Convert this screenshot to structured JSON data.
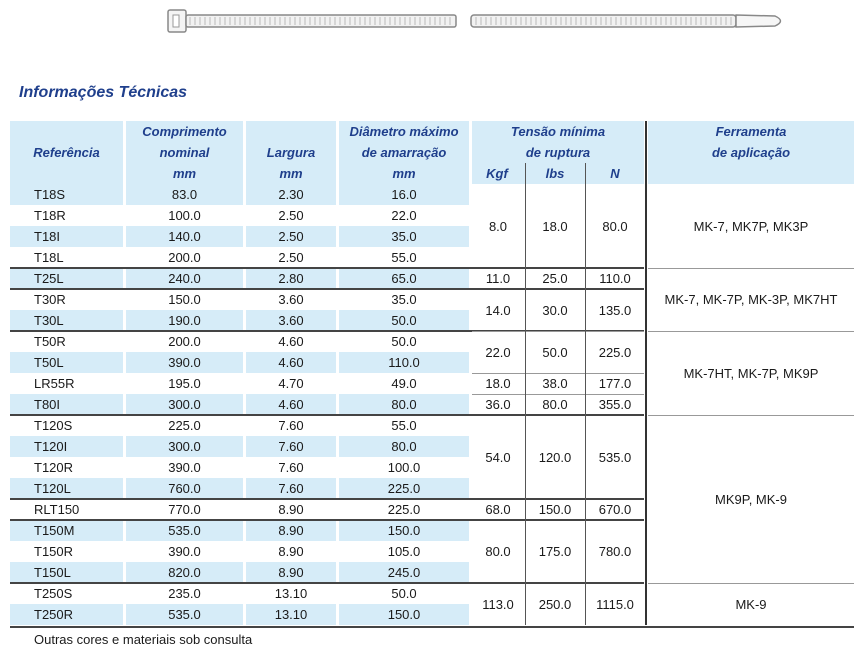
{
  "title": "Informações Técnicas",
  "headers": {
    "referencia": "Referência",
    "comprimento": [
      "Comprimento",
      "nominal",
      "mm"
    ],
    "largura": [
      "Largura",
      "mm"
    ],
    "diametro": [
      "Diâmetro máximo",
      "de amarração",
      "mm"
    ],
    "tensao": [
      "Tensão mínima",
      "de ruptura"
    ],
    "tensao_units": [
      "Kgf",
      "lbs",
      "N"
    ],
    "ferramenta": [
      "Ferramenta",
      "de aplicação"
    ]
  },
  "rows": [
    {
      "ref": "T18S",
      "comp": "83.0",
      "larg": "2.30",
      "diam": "16.0"
    },
    {
      "ref": "T18R",
      "comp": "100.0",
      "larg": "2.50",
      "diam": "22.0"
    },
    {
      "ref": "T18I",
      "comp": "140.0",
      "larg": "2.50",
      "diam": "35.0"
    },
    {
      "ref": "T18L",
      "comp": "200.0",
      "larg": "2.50",
      "diam": "55.0"
    },
    {
      "ref": "T25L",
      "comp": "240.0",
      "larg": "2.80",
      "diam": "65.0"
    },
    {
      "ref": "T30R",
      "comp": "150.0",
      "larg": "3.60",
      "diam": "35.0"
    },
    {
      "ref": "T30L",
      "comp": "190.0",
      "larg": "3.60",
      "diam": "50.0"
    },
    {
      "ref": "T50R",
      "comp": "200.0",
      "larg": "4.60",
      "diam": "50.0"
    },
    {
      "ref": "T50L",
      "comp": "390.0",
      "larg": "4.60",
      "diam": "110.0"
    },
    {
      "ref": "LR55R",
      "comp": "195.0",
      "larg": "4.70",
      "diam": "49.0"
    },
    {
      "ref": "T80I",
      "comp": "300.0",
      "larg": "4.60",
      "diam": "80.0"
    },
    {
      "ref": "T120S",
      "comp": "225.0",
      "larg": "7.60",
      "diam": "55.0"
    },
    {
      "ref": "T120I",
      "comp": "300.0",
      "larg": "7.60",
      "diam": "80.0"
    },
    {
      "ref": "T120R",
      "comp": "390.0",
      "larg": "7.60",
      "diam": "100.0"
    },
    {
      "ref": "T120L",
      "comp": "760.0",
      "larg": "7.60",
      "diam": "225.0"
    },
    {
      "ref": "RLT150",
      "comp": "770.0",
      "larg": "8.90",
      "diam": "225.0"
    },
    {
      "ref": "T150M",
      "comp": "535.0",
      "larg": "8.90",
      "diam": "150.0"
    },
    {
      "ref": "T150R",
      "comp": "390.0",
      "larg": "8.90",
      "diam": "105.0"
    },
    {
      "ref": "T150L",
      "comp": "820.0",
      "larg": "8.90",
      "diam": "245.0"
    },
    {
      "ref": "T250S",
      "comp": "235.0",
      "larg": "13.10",
      "diam": "50.0"
    },
    {
      "ref": "T250R",
      "comp": "535.0",
      "larg": "13.10",
      "diam": "150.0"
    }
  ],
  "tension_groups": [
    {
      "kgf": "8.0",
      "lbs": "18.0",
      "n": "80.0"
    },
    {
      "kgf": "11.0",
      "lbs": "25.0",
      "n": "110.0"
    },
    {
      "kgf": "14.0",
      "lbs": "30.0",
      "n": "135.0"
    },
    {
      "kgf": "22.0",
      "lbs": "50.0",
      "n": "225.0"
    },
    {
      "kgf": "18.0",
      "lbs": "38.0",
      "n": "177.0"
    },
    {
      "kgf": "36.0",
      "lbs": "80.0",
      "n": "355.0"
    },
    {
      "kgf": "54.0",
      "lbs": "120.0",
      "n": "535.0"
    },
    {
      "kgf": "68.0",
      "lbs": "150.0",
      "n": "670.0"
    },
    {
      "kgf": "80.0",
      "lbs": "175.0",
      "n": "780.0"
    },
    {
      "kgf": "113.0",
      "lbs": "250.0",
      "n": "1115.0"
    }
  ],
  "tool_groups": [
    "MK-7, MK7P, MK3P",
    "MK-7, MK-7P, MK-3P, MK7HT",
    "MK-7HT, MK-7P, MK9P",
    "MK9P, MK-9",
    "MK-9"
  ],
  "footnote": "Outras cores e materiais sob consulta"
}
